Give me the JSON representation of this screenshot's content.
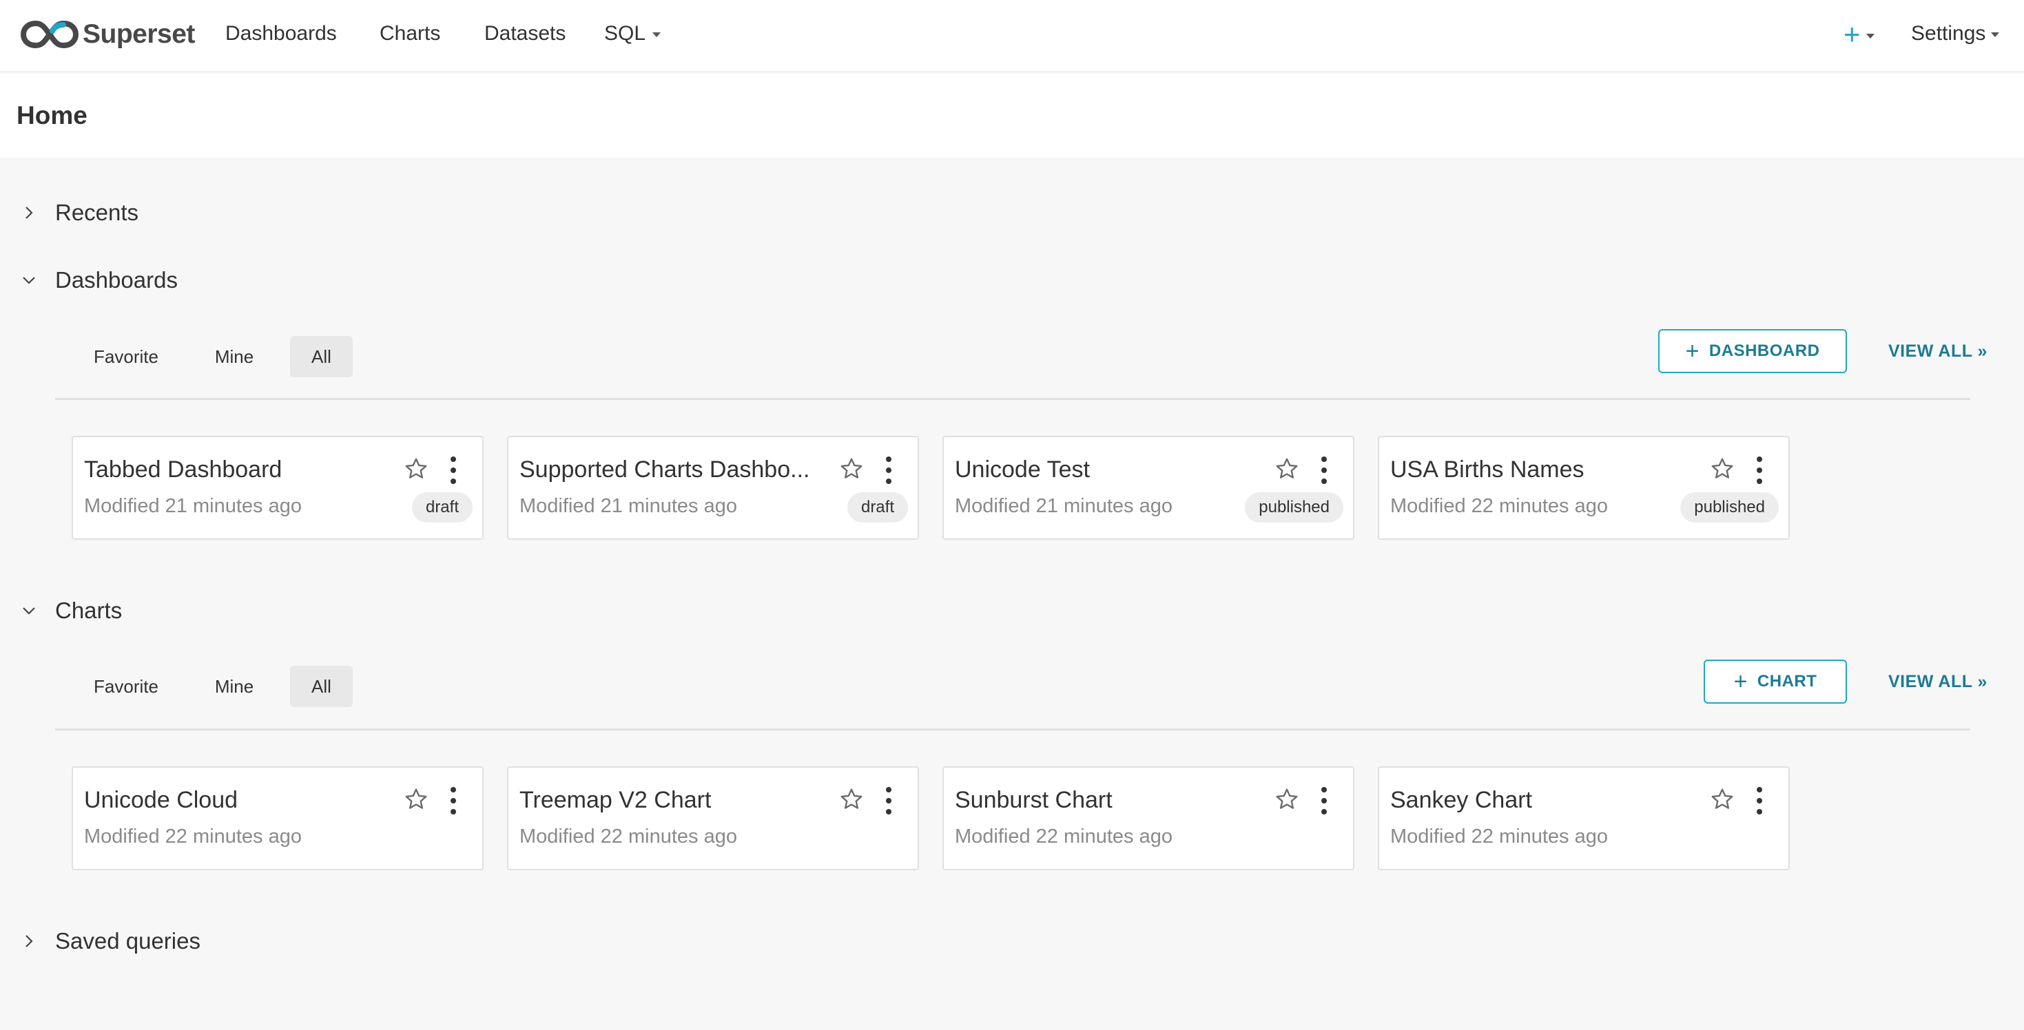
{
  "nav": {
    "brand": "Superset",
    "items": [
      "Dashboards",
      "Charts",
      "Datasets",
      "SQL"
    ],
    "plus": "+",
    "settings": "Settings"
  },
  "page": {
    "title": "Home"
  },
  "sections": {
    "recents": "Recents",
    "dashboards": "Dashboards",
    "charts": "Charts",
    "saved_queries": "Saved queries"
  },
  "tabs": {
    "favorite": "Favorite",
    "mine": "Mine",
    "all": "All"
  },
  "actions": {
    "add_dashboard": "DASHBOARD",
    "add_chart": "CHART",
    "view_all": "VIEW ALL »"
  },
  "dashboards": [
    {
      "title": "Tabbed Dashboard",
      "modified": "Modified 21 minutes ago",
      "status": "draft"
    },
    {
      "title": "Supported Charts Dashbo...",
      "modified": "Modified 21 minutes ago",
      "status": "draft"
    },
    {
      "title": "Unicode Test",
      "modified": "Modified 21 minutes ago",
      "status": "published"
    },
    {
      "title": "USA Births Names",
      "modified": "Modified 22 minutes ago",
      "status": "published"
    }
  ],
  "charts": [
    {
      "title": "Unicode Cloud",
      "modified": "Modified 22 minutes ago"
    },
    {
      "title": "Treemap V2 Chart",
      "modified": "Modified 22 minutes ago"
    },
    {
      "title": "Sunburst Chart",
      "modified": "Modified 22 minutes ago"
    },
    {
      "title": "Sankey Chart",
      "modified": "Modified 22 minutes ago"
    }
  ],
  "colors": {
    "accent": "#20a7c9",
    "accent_dark": "#1c7b94",
    "background": "#f7f7f7"
  },
  "icons": [
    "superset-logo-icon",
    "caret-down-icon",
    "chevron-right-icon",
    "chevron-down-icon",
    "star-icon",
    "more-vertical-icon",
    "plus-icon"
  ]
}
